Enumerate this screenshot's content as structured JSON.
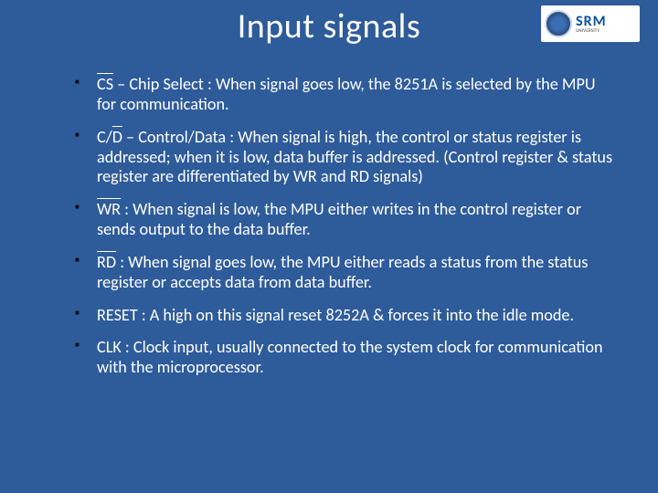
{
  "title": "Input signals",
  "logo": {
    "main": "SRM",
    "sub": "UNIVERSITY"
  },
  "bullets": [
    {
      "signal_html": "<span class=\"ov\">CS</span>",
      "text": " – Chip Select : When signal goes low, the 8251A is selected by the MPU for communication."
    },
    {
      "signal_html": "C/<span class=\"ov\">D</span>",
      "text": " – Control/Data : When signal is high, the control or status register is addressed; when it is low, data buffer is addressed. (Control register & status register are differentiated by WR and RD signals)"
    },
    {
      "signal_html": "<span class=\"ov\">WR</span>",
      "text": " : When signal is low, the MPU either writes in the control register or sends output to the data buffer."
    },
    {
      "signal_html": "<span class=\"ov\">RD</span>",
      "text": " : When signal goes low, the MPU either reads a status from the status register or accepts data from data buffer."
    },
    {
      "signal_html": "RESET",
      "text": " : A high on this signal reset 8252A & forces it into the idle mode."
    },
    {
      "signal_html": "CLK",
      "text": " : Clock input, usually connected to the system clock for communication with the microprocessor."
    }
  ]
}
